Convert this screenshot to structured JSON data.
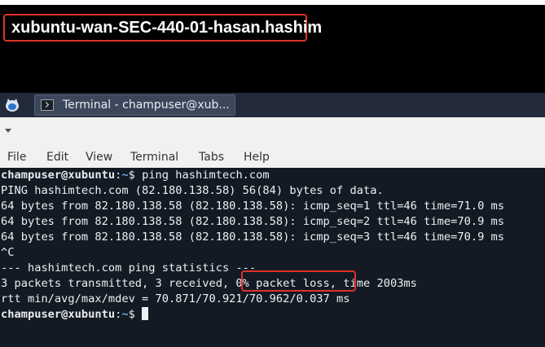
{
  "vm": {
    "title": "xubuntu-wan-SEC-440-01-hasan.hashim"
  },
  "taskbar": {
    "task_label": "Terminal - champuser@xub..."
  },
  "menu": [
    "File",
    "Edit",
    "View",
    "Terminal",
    "Tabs",
    "Help"
  ],
  "terminal": {
    "prompt_user": "champuser@xubuntu",
    "prompt_sep": ":",
    "prompt_path": "~",
    "prompt_end": "$ ",
    "command": "ping hashimtech.com",
    "output": [
      "PING hashimtech.com (82.180.138.58) 56(84) bytes of data.",
      "64 bytes from 82.180.138.58 (82.180.138.58): icmp_seq=1 ttl=46 time=71.0 ms",
      "64 bytes from 82.180.138.58 (82.180.138.58): icmp_seq=2 ttl=46 time=70.9 ms",
      "64 bytes from 82.180.138.58 (82.180.138.58): icmp_seq=3 ttl=46 time=70.9 ms",
      "^C",
      "--- hashimtech.com ping statistics ---"
    ],
    "stats_prefix": "3 packets transmitted, 3 received, ",
    "stats_highlight": "0% packet loss,",
    "stats_suffix": " time 2003ms",
    "rtt_line": "rtt min/avg/max/mdev = 70.871/70.921/70.962/0.037 ms"
  },
  "colors": {
    "highlight_border": "#e0302a",
    "terminal_bg": "#141a24",
    "taskbar_bg": "#232b3a"
  }
}
